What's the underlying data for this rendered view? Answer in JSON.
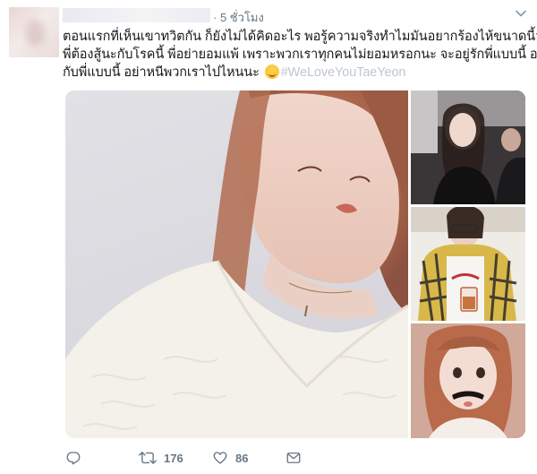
{
  "tweet": {
    "meta": "· 5 ชั่วโมง",
    "text_lines": [
      "ตอนแรกที่เห็นเขาทวิตกัน ก็ยังไม่ได้คิดอะไร พอรู้ความจริงทำไมมันอยากร้องไห้ขนาดนี้วะ",
      "พี่ต้องสู้นะกับโรคนี้ พี่อย่ายอมแพ้ เพราะพวกเราทุกคนไม่ยอมหรอกนะ จะอยู่รักพี่แบบนี้ อยู่",
      "กับพี่แบบนี้ อย่าหนีพวกเราไปไหนนะ"
    ],
    "hashtag": "#WeLoveYouTaeYeon"
  },
  "actions": {
    "reply_icon": "reply-icon",
    "retweet_icon": "retweet-icon",
    "retweet_count": "176",
    "like_icon": "heart-icon",
    "like_count": "86",
    "dm_icon": "envelope-icon"
  },
  "colors": {
    "text": "#14171a",
    "muted": "#657786",
    "hashtag": "#bfc7cf"
  }
}
